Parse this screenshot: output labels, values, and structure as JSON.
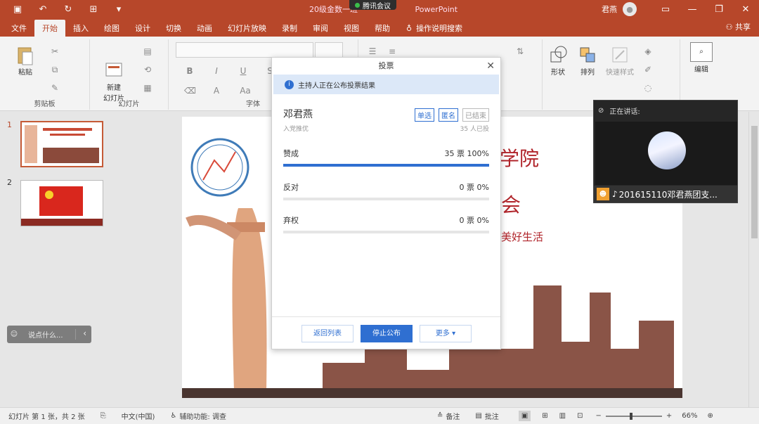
{
  "titlebar": {
    "title": "20级金数一班",
    "app_suffix": "PowerPoint",
    "meeting_label": "腾讯会议",
    "user": "君燕",
    "icons": [
      "save-icon",
      "undo-icon",
      "redo-icon",
      "present-icon",
      "customize-icon"
    ]
  },
  "tabs": [
    {
      "label": "文件"
    },
    {
      "label": "开始",
      "active": true
    },
    {
      "label": "插入"
    },
    {
      "label": "绘图"
    },
    {
      "label": "设计"
    },
    {
      "label": "切换"
    },
    {
      "label": "动画"
    },
    {
      "label": "幻灯片放映"
    },
    {
      "label": "录制"
    },
    {
      "label": "审阅"
    },
    {
      "label": "视图"
    },
    {
      "label": "帮助"
    }
  ],
  "tell_me": "操作说明搜索",
  "share": "共享",
  "ribbon": {
    "paste": "粘贴",
    "clipboard": "剪贴板",
    "new_slide": "新建\n幻灯片",
    "slides": "幻灯片",
    "font": "字体",
    "shapes": "形状",
    "arrange": "排列",
    "quick_styles": "快速样式",
    "edit": "编辑"
  },
  "thumbs": [
    {
      "num": "1",
      "selected": true
    },
    {
      "num": "2",
      "selected": false
    }
  ],
  "slide": {
    "title_part": "学院",
    "subtitle_part": "会",
    "slogan": "美好生活"
  },
  "chat": {
    "placeholder": "说点什么..."
  },
  "video": {
    "speaking_label": "正在讲话:",
    "participant": "201615110邓君燕团支..."
  },
  "vote": {
    "dialog_title": "投票",
    "notice": "主持人正在公布投票结果",
    "title": "邓君燕",
    "tags": [
      "单选",
      "匿名",
      "已结束"
    ],
    "subtitle": "入党推优",
    "count": "35 人已投",
    "options": [
      {
        "label": "赞成",
        "result": "35 票 100%",
        "pct": 100
      },
      {
        "label": "反对",
        "result": "0 票 0%",
        "pct": 0
      },
      {
        "label": "弃权",
        "result": "0 票 0%",
        "pct": 0
      }
    ],
    "buttons": {
      "back": "返回列表",
      "stop": "停止公布",
      "more": "更多"
    }
  },
  "status": {
    "slide_info": "幻灯片 第 1 张，共 2 张",
    "language": "中文(中国)",
    "accessibility": "辅助功能: 调查",
    "notes": "备注",
    "comments": "批注",
    "zoom": "66%"
  },
  "colors": {
    "accent": "#b7472a",
    "vote_blue": "#2f6fd1"
  }
}
